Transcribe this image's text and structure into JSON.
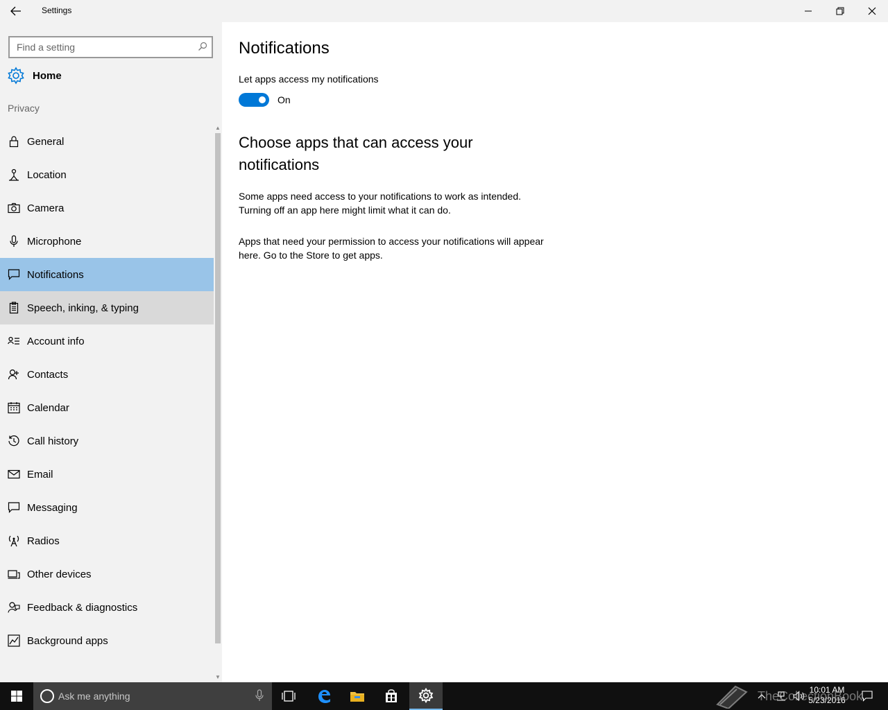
{
  "window": {
    "title": "Settings"
  },
  "sidebar": {
    "search_placeholder": "Find a setting",
    "home_label": "Home",
    "section_label": "Privacy",
    "items": [
      {
        "label": "General",
        "icon": "lock-icon"
      },
      {
        "label": "Location",
        "icon": "location-person-icon"
      },
      {
        "label": "Camera",
        "icon": "camera-icon"
      },
      {
        "label": "Microphone",
        "icon": "microphone-icon"
      },
      {
        "label": "Notifications",
        "icon": "speech-bubble-icon",
        "state": "selected"
      },
      {
        "label": "Speech, inking, & typing",
        "icon": "clipboard-icon",
        "state": "hover"
      },
      {
        "label": "Account info",
        "icon": "account-card-icon"
      },
      {
        "label": "Contacts",
        "icon": "contacts-icon"
      },
      {
        "label": "Calendar",
        "icon": "calendar-icon"
      },
      {
        "label": "Call history",
        "icon": "history-icon"
      },
      {
        "label": "Email",
        "icon": "envelope-icon"
      },
      {
        "label": "Messaging",
        "icon": "message-icon"
      },
      {
        "label": "Radios",
        "icon": "radio-tower-icon"
      },
      {
        "label": "Other devices",
        "icon": "devices-icon"
      },
      {
        "label": "Feedback & diagnostics",
        "icon": "feedback-icon"
      },
      {
        "label": "Background apps",
        "icon": "background-apps-icon"
      }
    ]
  },
  "main": {
    "title": "Notifications",
    "toggle_label": "Let apps access my notifications",
    "toggle_state": "On",
    "subheading": "Choose apps that can access your notifications",
    "paragraph1": "Some apps need access to your notifications to work as intended. Turning off an app here might limit what it can do.",
    "paragraph2": "Apps that need your permission to access your notifications will appear here. Go to the Store to get apps."
  },
  "taskbar": {
    "search_placeholder": "Ask me anything",
    "time": "10:01 AM",
    "date": "5/23/2016"
  },
  "watermark": "TheCollectionBook",
  "colors": {
    "accent": "#0078d7",
    "selected_item": "#99c4e8",
    "hover_item": "#d9d9d9",
    "sidebar_bg": "#f2f2f2",
    "taskbar_bg": "#101010"
  }
}
